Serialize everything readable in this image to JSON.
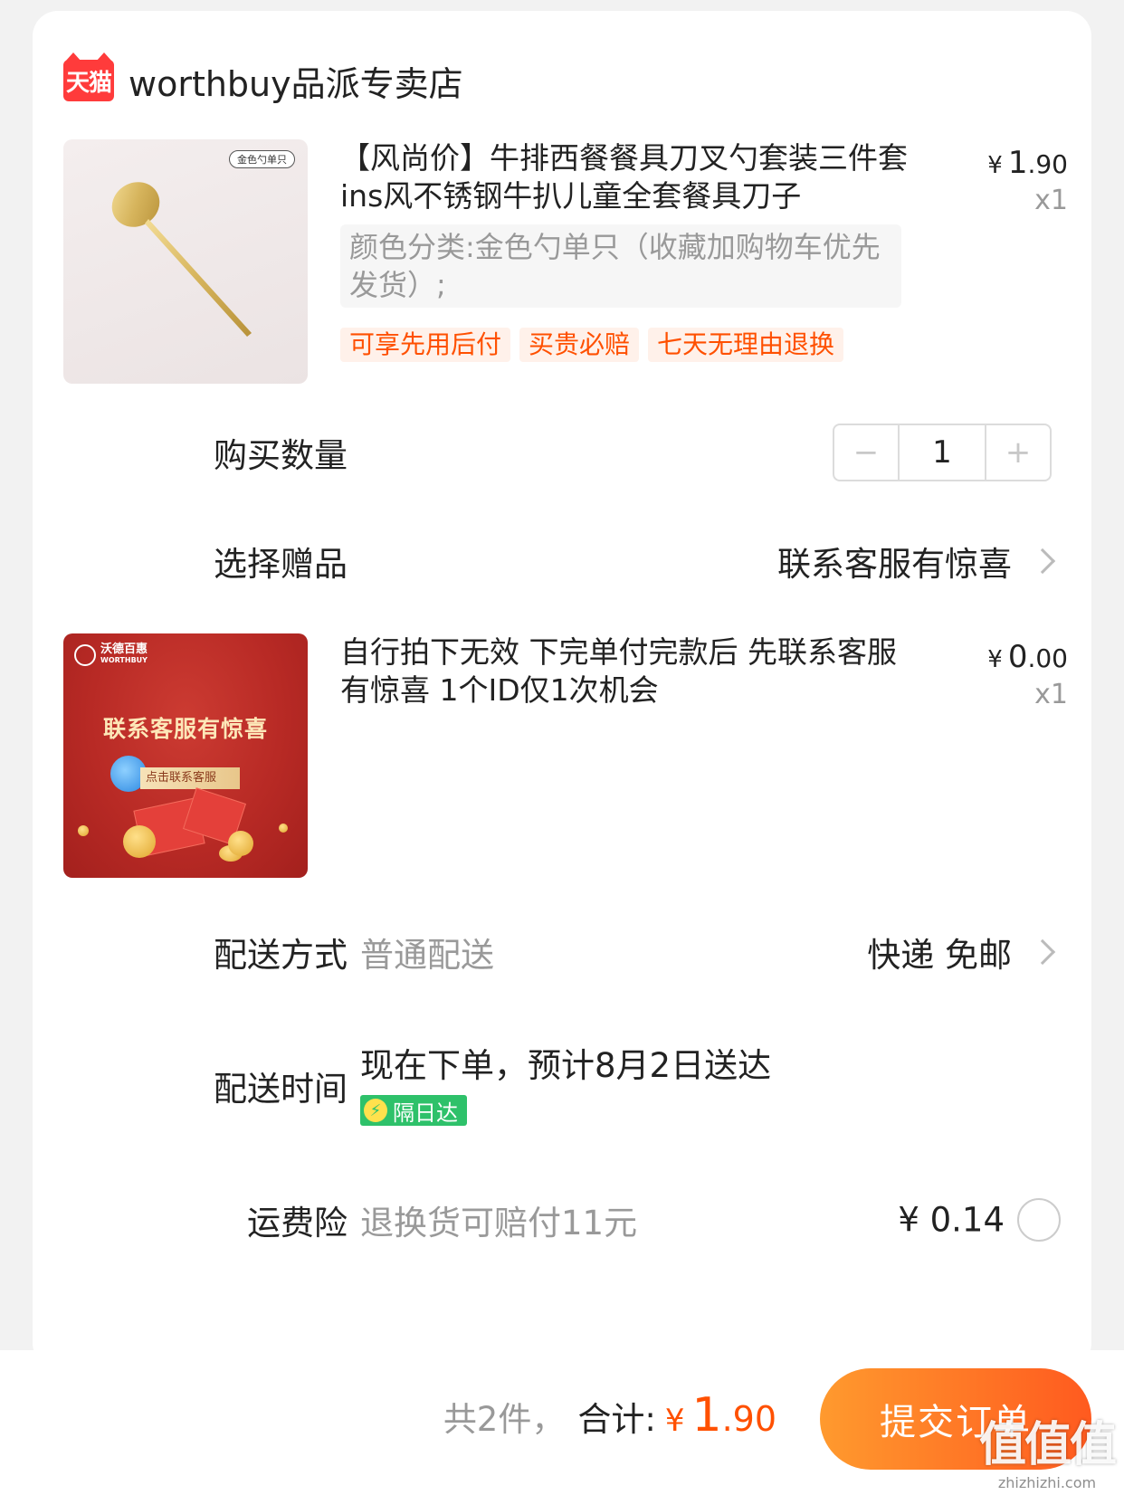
{
  "store": {
    "platform_badge": "天猫",
    "name": "worthbuy品派专卖店"
  },
  "items": [
    {
      "title": "【风尚价】牛排西餐餐具刀叉勺套装三件套ins风不锈钢牛扒儿童全套餐具刀子",
      "image_tag": "金色勺单只",
      "price_symbol": "¥",
      "price_int": "1",
      "price_dec": ".90",
      "qty": "x1",
      "sku": "颜色分类:金色勺单只（收藏加购物车优先发货）;",
      "tags": [
        "可享先用后付",
        "买贵必赔",
        "七天无理由退换"
      ]
    },
    {
      "title": "自行拍下无效 下完单付完款后 先联系客服 有惊喜 1个ID仅1次机会",
      "image_logo": "沃德百惠",
      "image_logo_sub": "WORTHBUY",
      "image_title": "联系客服有惊喜",
      "image_button": "点击联系客服",
      "price_symbol": "¥",
      "price_int": "0",
      "price_dec": ".00",
      "qty": "x1"
    }
  ],
  "quantity": {
    "label": "购买数量",
    "minus": "−",
    "value": "1",
    "plus": "+"
  },
  "gift": {
    "label": "选择赠品",
    "value": "联系客服有惊喜"
  },
  "shipping": {
    "label": "配送方式",
    "method": "普通配送",
    "value": "快递 免邮"
  },
  "delivery_time": {
    "label": "配送时间",
    "text": "现在下单，预计8月2日送达",
    "badge": "隔日达",
    "badge_icon": "⚡"
  },
  "insurance": {
    "label": "运费险",
    "desc": "退换货可赔付11元",
    "price": "¥ 0.14"
  },
  "footer": {
    "count": "共2件，",
    "total_label": "合计:",
    "total_symbol": "¥",
    "total_int": "1",
    "total_dec": ".90",
    "submit": "提交订单",
    "watermark_big": "值值值",
    "watermark_small": "zhizhizhi.com"
  },
  "colors": {
    "accent": "#ff5000",
    "tmall_red": "#ff3b3b",
    "next_day_green": "#2ec16a"
  }
}
